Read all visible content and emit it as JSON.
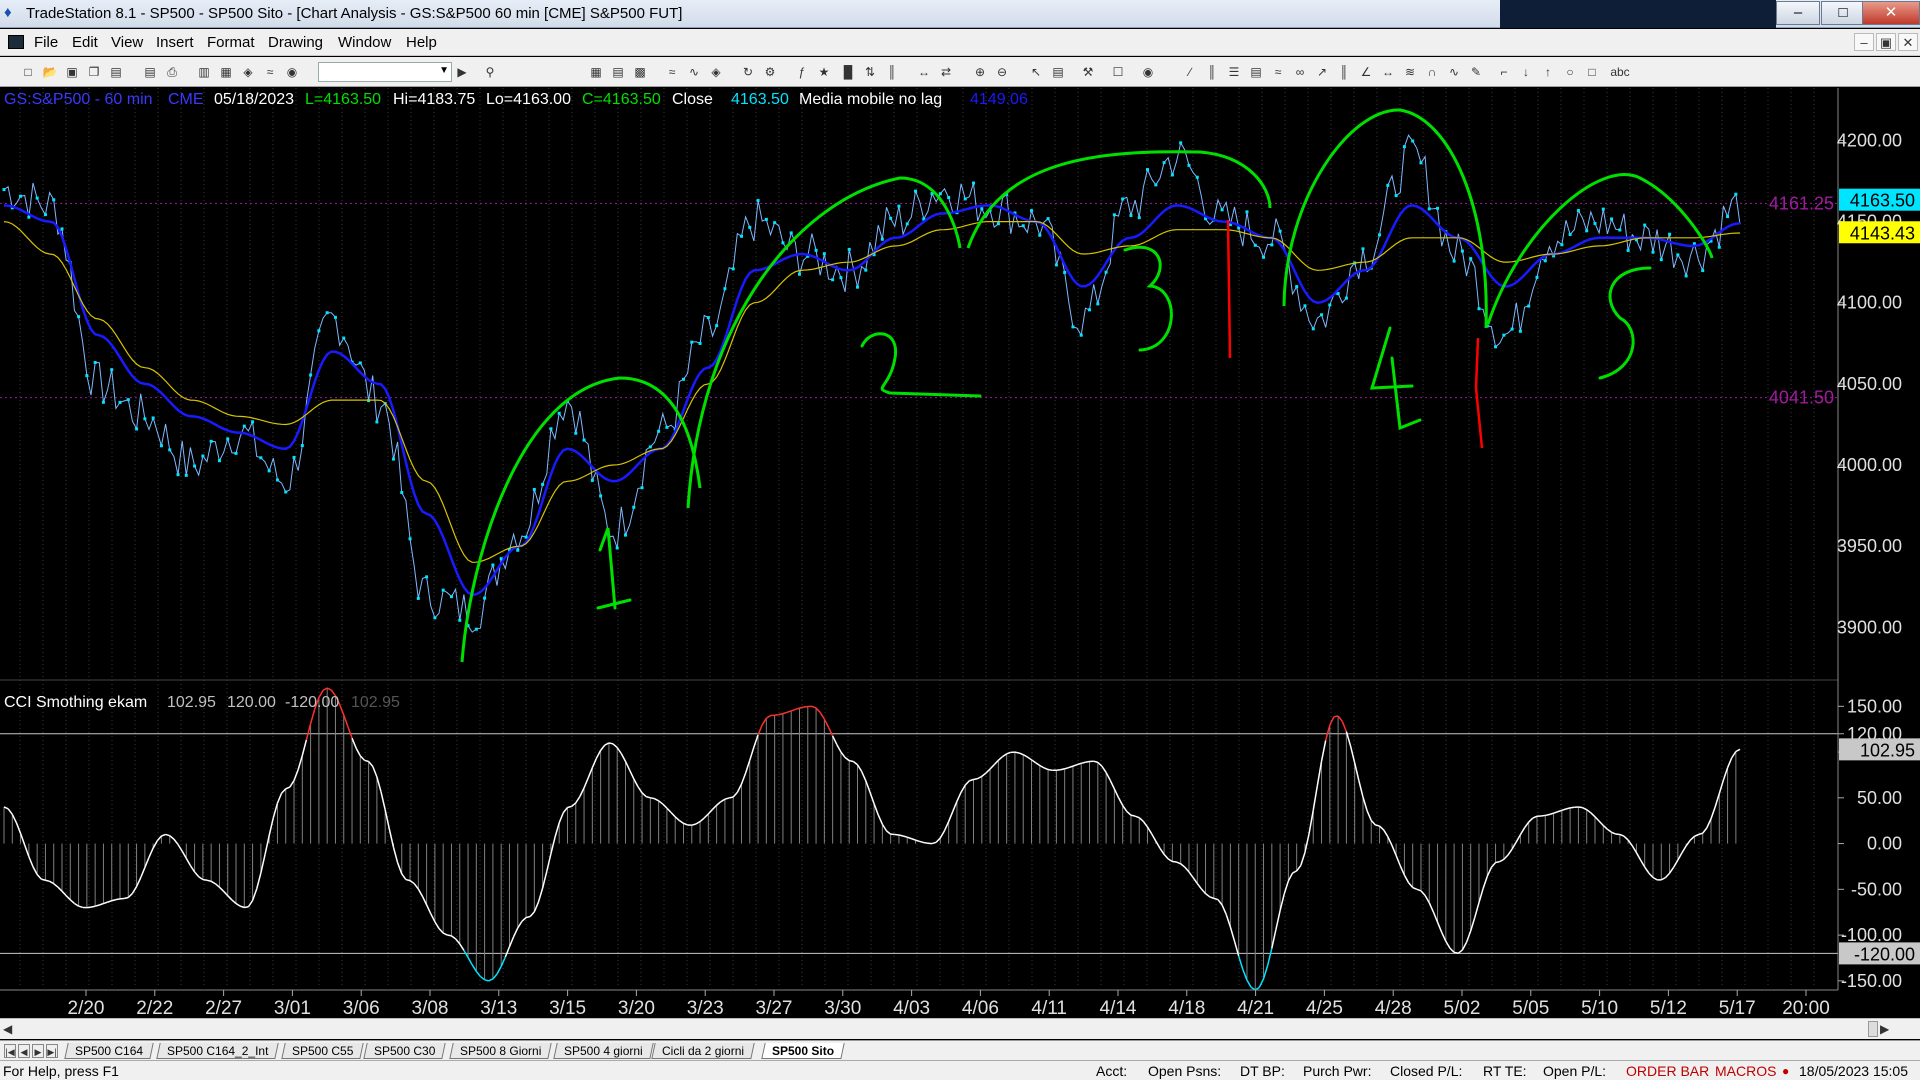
{
  "window": {
    "title": "TradeStation 8.1 - SP500 - SP500 Sito - [Chart Analysis - GS:S&P500  60 min  [CME] S&P500 FUT]",
    "app_icon": "tradestation-logo-icon",
    "min": "–",
    "max": "□",
    "close": "✕"
  },
  "menu": [
    "File",
    "Edit",
    "View",
    "Insert",
    "Format",
    "Drawing",
    "Window",
    "Help"
  ],
  "mdi": {
    "min": "–",
    "restore": "▣",
    "close": "✕"
  },
  "chart_header": {
    "symbol": "GS:S&P500 - 60 min",
    "exchange": "CME",
    "date": "05/18/2023",
    "last": "L=4163.50",
    "hi": "Hi=4183.75",
    "lo": "Lo=4163.00",
    "close_val": "C=4163.50",
    "close_label": "Close",
    "close_price": "4163.50",
    "ma_label": "Media mobile no lag",
    "ma_value": "4149.06"
  },
  "indicator_header": {
    "name": "CCI Smothing ekam",
    "v1": "102.95",
    "v2": "120.00",
    "v3": "-120.00",
    "v4": "102.95"
  },
  "price_axis": {
    "ticks": [
      "4200.00",
      "4150.00",
      "4100.00",
      "4050.00",
      "4000.00",
      "3950.00",
      "3900.00"
    ],
    "line_label_upper": "4161.25",
    "line_label_lower": "4041.50",
    "last_price_tag": "4163.50",
    "ma_tag": "4143.43"
  },
  "cci_axis": {
    "ticks": [
      "150.00",
      "120.00",
      "100.00",
      "50.00",
      "0.00",
      "-50.00",
      "-100.00",
      "-150.00"
    ],
    "value_tag": "102.95",
    "lower_tag": "-120.00"
  },
  "date_axis": [
    "2/20",
    "2/22",
    "2/27",
    "3/01",
    "3/06",
    "3/08",
    "3/13",
    "3/15",
    "3/20",
    "3/23",
    "3/27",
    "3/30",
    "4/03",
    "4/06",
    "4/11",
    "4/14",
    "4/18",
    "4/21",
    "4/25",
    "4/28",
    "5/02",
    "5/05",
    "5/10",
    "5/12",
    "5/17",
    "20:00"
  ],
  "annotations": [
    "1",
    "2",
    "3",
    "4",
    "5"
  ],
  "tabs": [
    "SP500 C164",
    "SP500 C164_2_Int",
    "SP500 C55",
    "SP500 C30",
    "SP500 8 Giorni",
    "SP500 4 giorni",
    "Cicli da 2 giorni",
    "SP500 Sito"
  ],
  "active_tab": "SP500 Sito",
  "status": {
    "help": "For Help, press F1",
    "acct": "Acct:",
    "open_psns": "Open Psns:",
    "dt_bp": "DT BP:",
    "purch_pwr": "Purch Pwr:",
    "closed_pl": "Closed P/L:",
    "rt_te": "RT TE:",
    "open_pl": "Open P/L:",
    "order_bar": "ORDER BAR",
    "macros": "MACROS",
    "datetime": "18/05/2023 15:05"
  },
  "colors": {
    "price": "#00e5ff",
    "ma_blue": "#1a1aff",
    "ma_yellow": "#d6c400",
    "drawing_green": "#00e000",
    "drawing_red": "#ff0000",
    "cci_line": "#ffffff",
    "cci_over": "#ff3030",
    "cci_under": "#00e5ff",
    "hline_purple": "#a01aa0"
  },
  "chart_data": {
    "type": "line",
    "ylim": [
      3870,
      4220
    ],
    "dates": [
      "2/20",
      "2/22",
      "2/27",
      "3/01",
      "3/06",
      "3/08",
      "3/13",
      "3/15",
      "3/20",
      "3/23",
      "3/27",
      "3/30",
      "4/03",
      "4/06",
      "4/11",
      "4/14",
      "4/18",
      "4/21",
      "4/25",
      "4/28",
      "5/02",
      "5/05",
      "5/10",
      "5/12",
      "5/17"
    ],
    "series": [
      {
        "values": [
          4170,
          4160,
          4050,
          4030,
          4000,
          4020,
          3990,
          4090,
          4040,
          3920,
          3910,
          3960,
          4040,
          3960,
          4020,
          4080,
          4150,
          4130,
          4120,
          4150,
          4170,
          4160,
          4150,
          4090,
          4160,
          4190,
          4150,
          4140,
          4090,
          4130,
          4190,
          4130,
          4080,
          4140,
          4150,
          4140,
          4130,
          4160
        ]
      },
      {
        "values": [
          4160,
          4150,
          4080,
          4050,
          4030,
          4020,
          4010,
          4070,
          4050,
          3970,
          3920,
          3950,
          4010,
          3990,
          4010,
          4060,
          4120,
          4130,
          4120,
          4140,
          4155,
          4160,
          4150,
          4110,
          4140,
          4160,
          4150,
          4140,
          4100,
          4120,
          4160,
          4140,
          4110,
          4130,
          4140,
          4140,
          4135,
          4149
        ]
      },
      {
        "values": [
          4150,
          4130,
          4090,
          4060,
          4040,
          4030,
          4025,
          4040,
          4040,
          3990,
          3940,
          3950,
          3990,
          4000,
          4010,
          4050,
          4100,
          4120,
          4125,
          4135,
          4145,
          4150,
          4150,
          4130,
          4135,
          4145,
          4145,
          4140,
          4120,
          4125,
          4140,
          4140,
          4125,
          4130,
          4135,
          4140,
          4140,
          4143
        ]
      }
    ],
    "cci": {
      "ylim": [
        -160,
        170
      ],
      "values": [
        40,
        -40,
        -70,
        -60,
        10,
        -40,
        -70,
        60,
        170,
        90,
        -40,
        -100,
        -150,
        -80,
        40,
        110,
        50,
        20,
        50,
        140,
        150,
        90,
        10,
        0,
        70,
        100,
        80,
        90,
        30,
        -20,
        -60,
        -160,
        -30,
        140,
        20,
        -50,
        -120,
        -20,
        30,
        40,
        10,
        -40,
        10,
        103
      ]
    }
  }
}
